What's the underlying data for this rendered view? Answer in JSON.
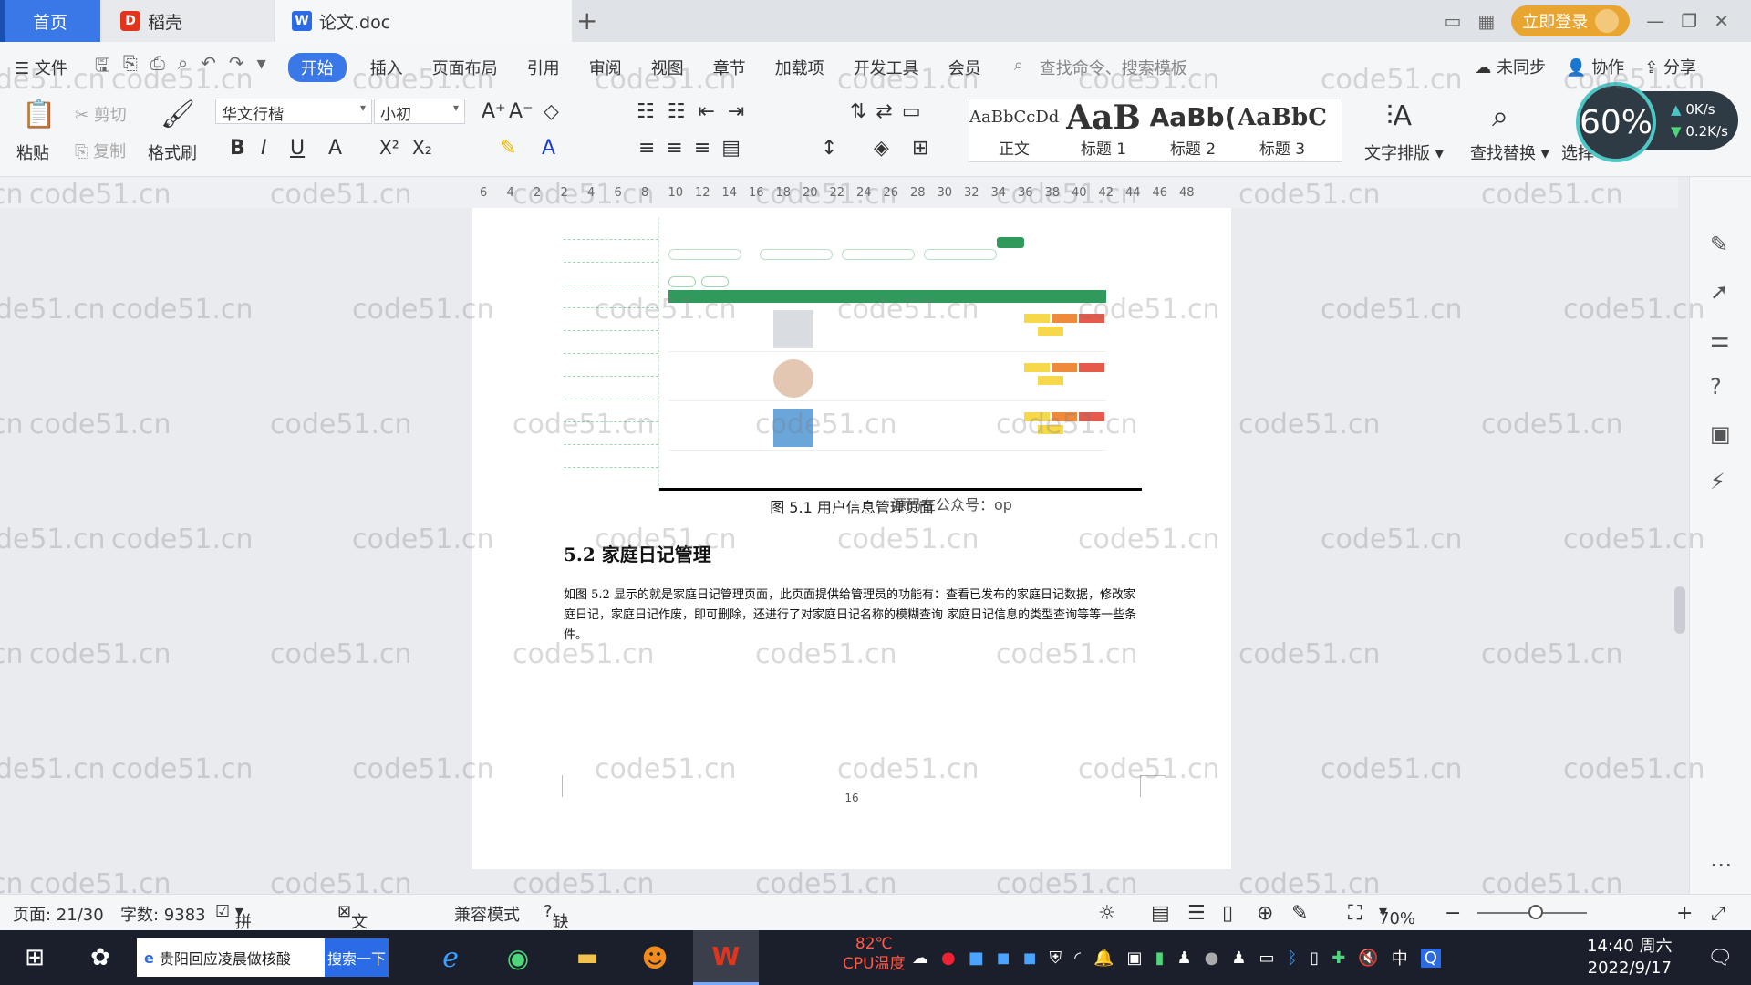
{
  "tabs": {
    "home": "首页",
    "daoke": "稻壳",
    "doc": "论文.doc"
  },
  "titlebar": {
    "login": "立即登录"
  },
  "menu": {
    "file": "文件",
    "items": [
      "开始",
      "插入",
      "页面布局",
      "引用",
      "审阅",
      "视图",
      "章节",
      "加载项",
      "开发工具",
      "会员"
    ],
    "search_cmd": "查找命令、搜索模板",
    "unsync": "未同步",
    "collab": "协作",
    "share": "分享"
  },
  "ribbon": {
    "paste": "粘贴",
    "cut": "剪切",
    "copy": "复制",
    "format_painter": "格式刷",
    "font": "华文行楷",
    "size": "小初",
    "styles": [
      {
        "preview": "AaBbCcDd",
        "label": "正文"
      },
      {
        "preview": "AaB",
        "label": "标题 1"
      },
      {
        "preview": "AaBb(",
        "label": "标题 2"
      },
      {
        "preview": "AaBbC",
        "label": "标题 3"
      }
    ],
    "text_layout": "文字排版",
    "find_replace": "查找替换",
    "select": "选择"
  },
  "netmon": {
    "percent": "60%",
    "up": "0K/s",
    "down": "0.2K/s"
  },
  "ruler": [
    "6",
    "4",
    "2",
    "2",
    "4",
    "6",
    "8",
    "10",
    "12",
    "14",
    "16",
    "18",
    "20",
    "22",
    "24",
    "26",
    "28",
    "30",
    "32",
    "34",
    "36",
    "38",
    "40",
    "42",
    "44",
    "46",
    "48"
  ],
  "document": {
    "caption": "图 5.1 用户信息管理页面",
    "overlay": "源码在公众号：op",
    "heading": "5.2  家庭日记管理",
    "paragraph": "如图 5.2 显示的就是家庭日记管理页面，此页面提供给管理员的功能有：查看已发布的家庭日记数据，修改家庭日记，家庭日记作废，即可删除，还进行了对家庭日记名称的模糊查询 家庭日记信息的类型查询等等一些条件。",
    "page_number": "16"
  },
  "statusbar": {
    "page": "页面: 21/30",
    "words": "字数: 9383",
    "spell": "拼写检查",
    "proof": "文档校对",
    "compat": "兼容模式",
    "missing_font": "缺失字体",
    "zoom": "70%"
  },
  "taskbar": {
    "search_text": "贵阳回应凌晨做核酸",
    "search_button": "搜索一下",
    "temp_value": "82℃",
    "temp_label": "CPU温度",
    "ime": "中",
    "time": "14:40 周六",
    "date": "2022/9/17"
  },
  "watermark": "code51.cn"
}
